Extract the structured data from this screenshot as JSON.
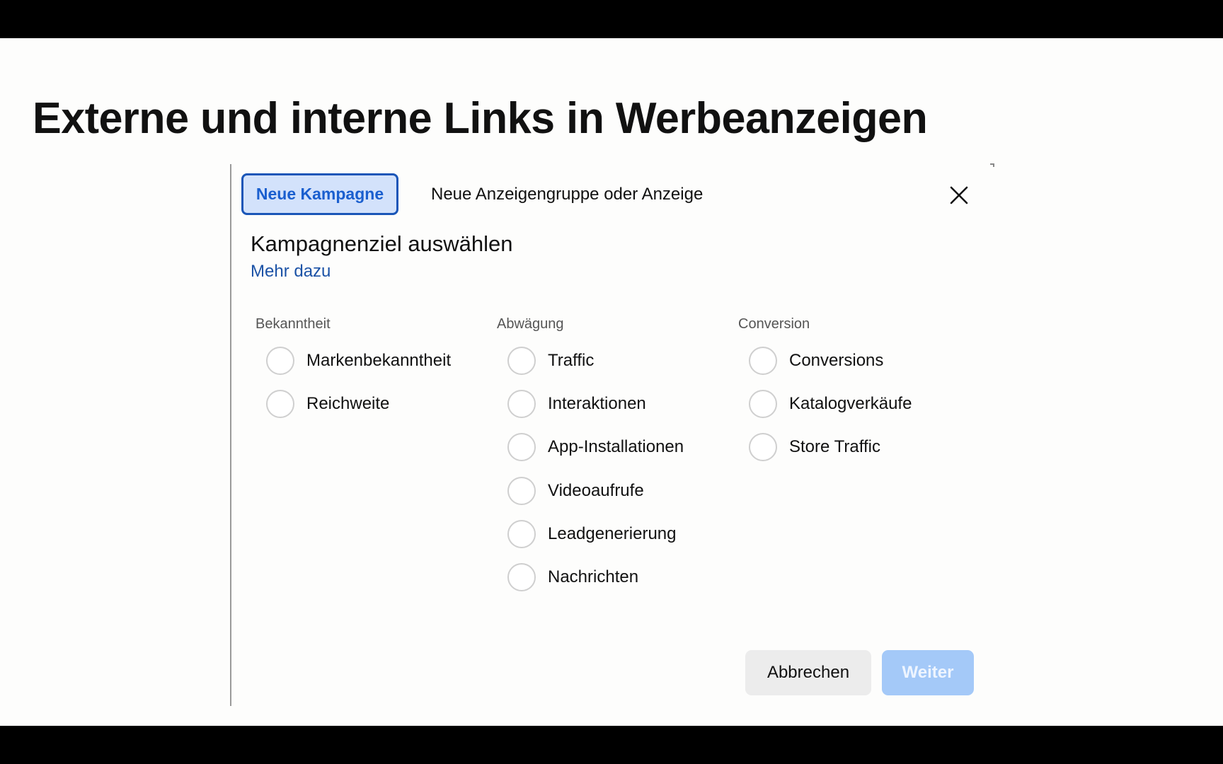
{
  "slide": {
    "title": "Externe und interne Links in Werbeanzeigen"
  },
  "dialog": {
    "tabs": [
      {
        "label": "Neue Kampagne",
        "active": true
      },
      {
        "label": "Neue Anzeigengruppe oder Anzeige",
        "active": false
      }
    ],
    "close_icon": "close-icon",
    "heading": "Kampagnenziel auswählen",
    "more_link": "Mehr dazu",
    "columns": [
      {
        "label": "Bekanntheit",
        "options": [
          "Markenbekanntheit",
          "Reichweite"
        ]
      },
      {
        "label": "Abwägung",
        "options": [
          "Traffic",
          "Interaktionen",
          "App-Installationen",
          "Videoaufrufe",
          "Leadgenerierung",
          "Nachrichten"
        ]
      },
      {
        "label": "Conversion",
        "options": [
          "Conversions",
          "Katalogverkäufe",
          "Store Traffic"
        ]
      }
    ],
    "buttons": {
      "cancel": "Abbrechen",
      "next": "Weiter"
    },
    "colors": {
      "accent": "#1a56b8",
      "tab_active_bg": "#d3e2fb",
      "link": "#1b52a6",
      "next_disabled_bg": "#a4c9f8"
    }
  }
}
